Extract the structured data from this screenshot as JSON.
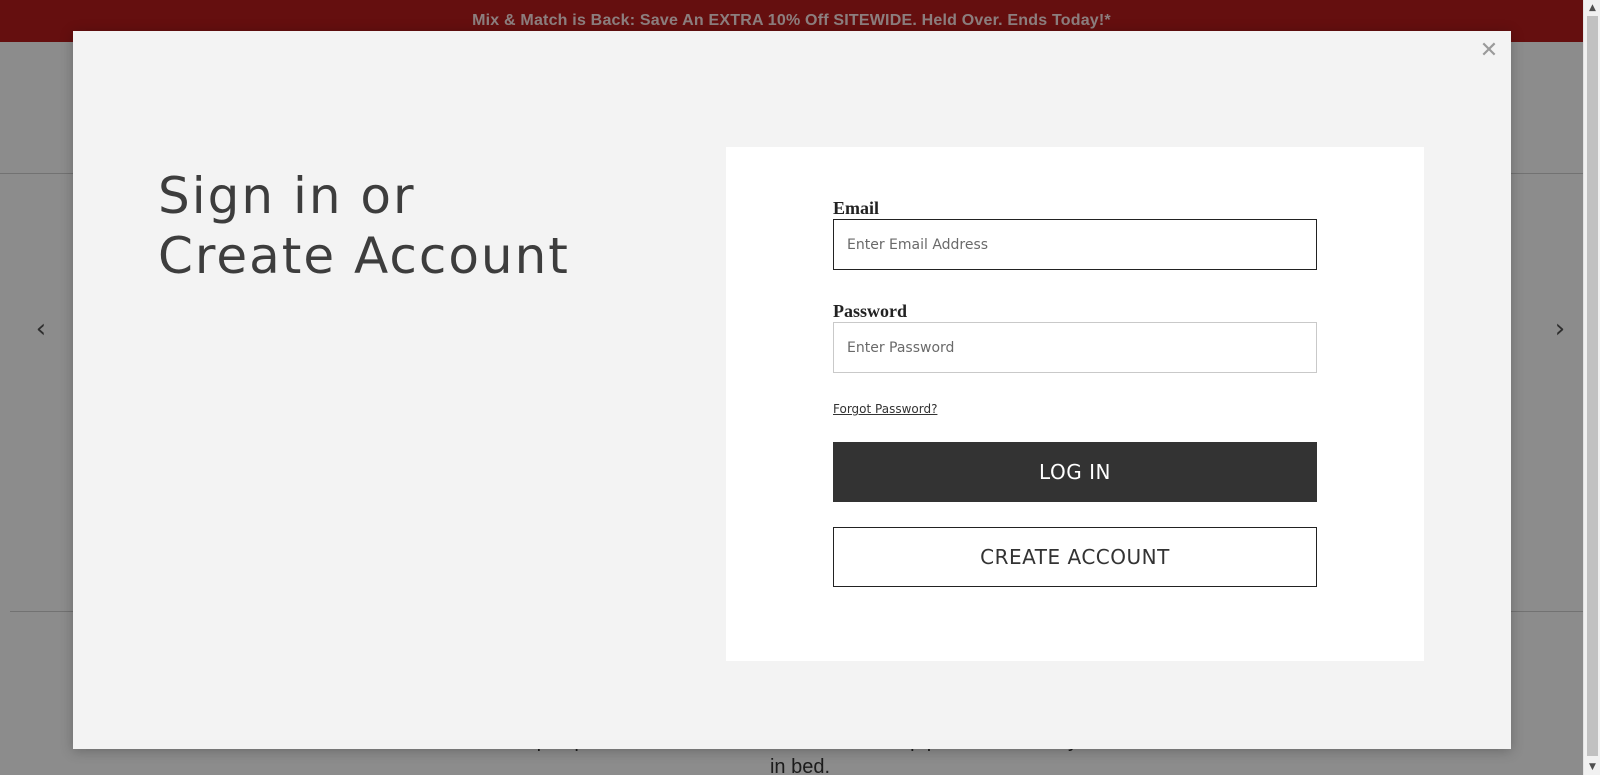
{
  "promo": {
    "text": "Mix & Match is Back: Save An EXTRA 10% Off SITEWIDE. Held Over. Ends Today!*"
  },
  "background": {
    "tagline": "We're sleep experts. See what we recommend to help put Zzzs above your head in bed.",
    "arrow_left": "‹",
    "arrow_right": "›"
  },
  "modal": {
    "close_glyph": "✕",
    "heading_line1": "Sign in or",
    "heading_line2": "Create Account",
    "form": {
      "email_label": "Email",
      "email_placeholder": "Enter Email Address",
      "email_value": "",
      "password_label": "Password",
      "password_placeholder": "Enter Password",
      "password_value": "",
      "forgot_link": "Forgot Password?",
      "login_button": "LOG IN",
      "create_button": "CREATE ACCOUNT"
    }
  },
  "scrollbar": {
    "up_glyph": "▲",
    "down_glyph": "▼"
  },
  "colors": {
    "promo_bg": "#b91d1d",
    "modal_bg": "#f3f3f3",
    "login_button_bg": "#333333"
  },
  "icons": {
    "close": "close-icon",
    "arrow_left": "chevron-left-icon",
    "arrow_right": "chevron-right-icon"
  }
}
